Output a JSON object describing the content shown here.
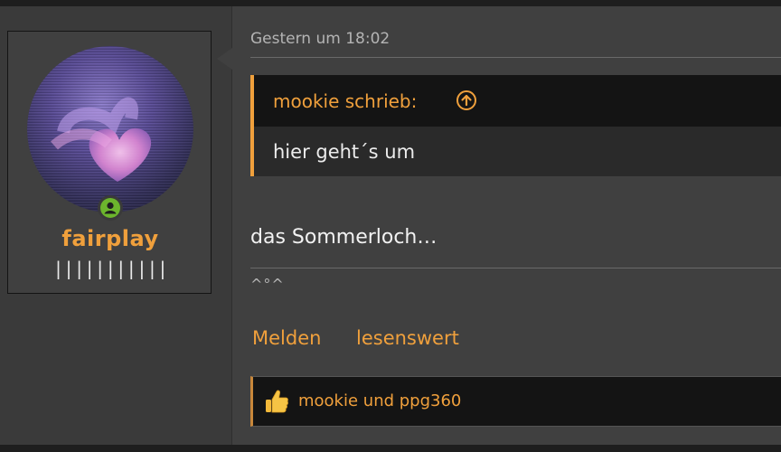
{
  "user": {
    "name": "fairplay",
    "rank": "|||||||||||",
    "avatar_icon": "heart-avatar-icon",
    "status_icon": "user-online-icon",
    "status_color": "#6cb52d"
  },
  "post": {
    "date": "Gestern um 18:02",
    "quote": {
      "author_line": "mookie schrieb:",
      "jump_icon": "arrow-up-circle-icon",
      "text": "hier geht´s um"
    },
    "message": "das Sommerloch…",
    "signature": "^°^",
    "actions": {
      "report": "Melden",
      "like": "lesenswert"
    },
    "likes": {
      "icon": "thumbs-up-icon",
      "text": "mookie und ppg360"
    }
  },
  "colors": {
    "accent": "#f0a03c",
    "background": "#3a3a3a",
    "panel": "#404040",
    "dark": "#141414"
  }
}
